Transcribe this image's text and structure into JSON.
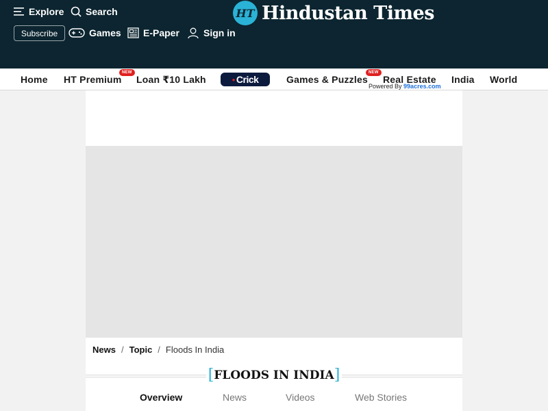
{
  "header": {
    "explore": "Explore",
    "search": "Search",
    "subscribe": "Subscribe",
    "games": "Games",
    "epaper": "E-Paper",
    "signin": "Sign in",
    "logo_mark": "HT",
    "logo_text": "Hindustan Times"
  },
  "nav": {
    "items": [
      {
        "label": "Home"
      },
      {
        "label": "HT Premium",
        "badge": "NEW"
      },
      {
        "label": "Loan ₹10 Lakh"
      },
      {
        "label": "Crick"
      },
      {
        "label": "Games & Puzzles",
        "badge": "NEW"
      },
      {
        "label": "Real Estate"
      },
      {
        "label": "India"
      },
      {
        "label": "World"
      }
    ],
    "powered_by": "Powered By",
    "powered_brand": "99acres.com"
  },
  "breadcrumb": {
    "items": [
      "News",
      "Topic",
      "Floods In India"
    ],
    "separator": "/"
  },
  "topic": {
    "open_bracket": "[",
    "title": "FLOODS IN INDIA",
    "close_bracket": "]"
  },
  "tabs": [
    "Overview",
    "News",
    "Videos",
    "Web Stories"
  ],
  "colors": {
    "header_bg": "#0c2530",
    "accent": "#2ab3d6",
    "badge": "#e02020",
    "crick_bg": "#0b1a3d"
  }
}
